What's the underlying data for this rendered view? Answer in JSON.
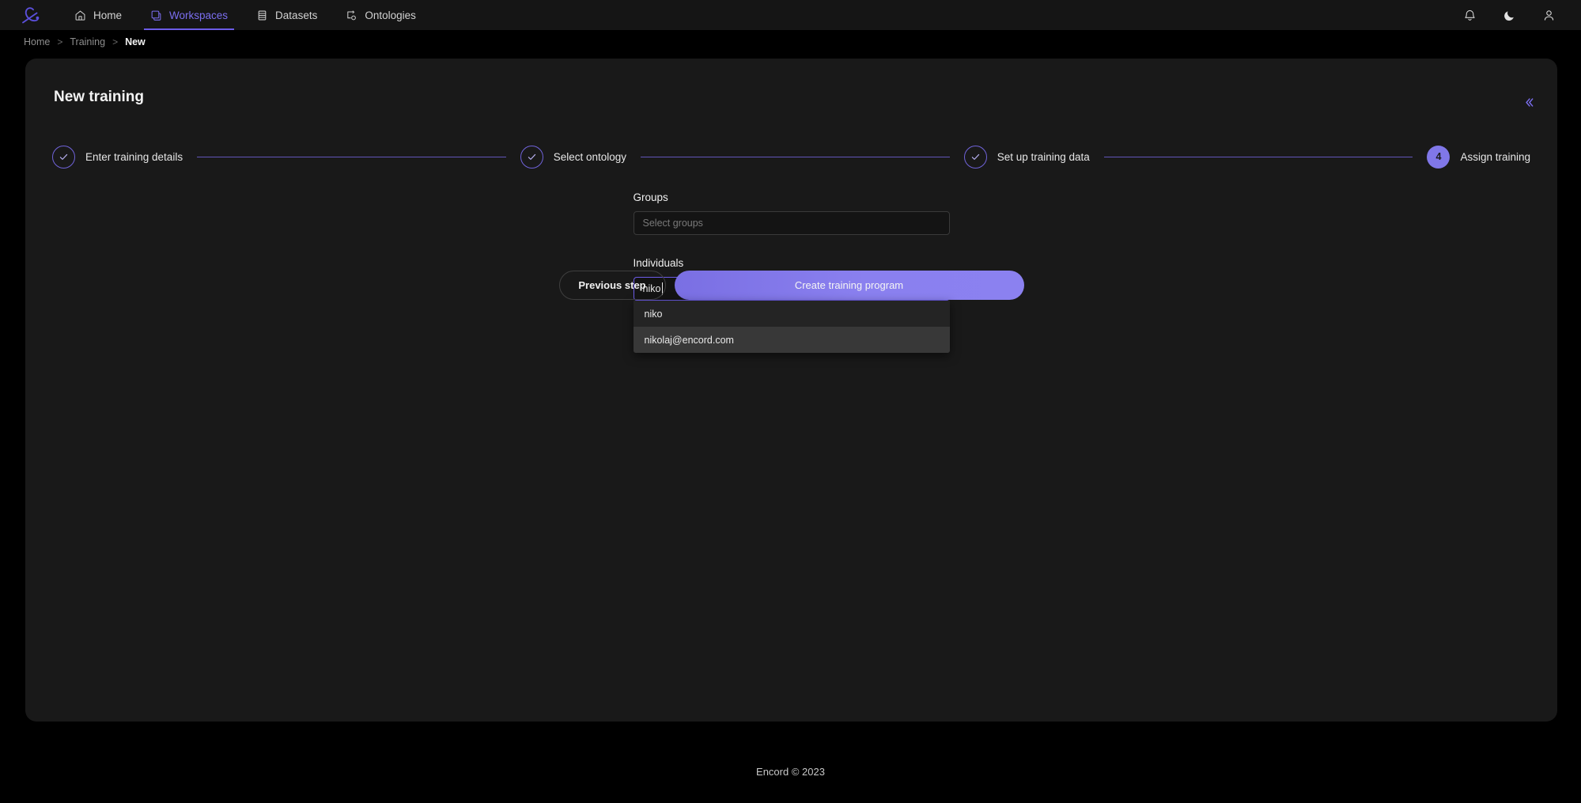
{
  "nav": {
    "logo_icon": "encord-logo-icon",
    "items": [
      {
        "label": "Home",
        "icon": "home-icon",
        "active": false
      },
      {
        "label": "Workspaces",
        "icon": "workspaces-icon",
        "active": true
      },
      {
        "label": "Datasets",
        "icon": "datasets-icon",
        "active": false
      },
      {
        "label": "Ontologies",
        "icon": "ontologies-icon",
        "active": false
      }
    ],
    "right_icons": [
      {
        "name": "notifications-bell-icon"
      },
      {
        "name": "dark-mode-moon-icon"
      },
      {
        "name": "user-account-icon"
      }
    ]
  },
  "breadcrumb": {
    "items": [
      {
        "label": "Home"
      },
      {
        "label": "Training"
      },
      {
        "label": "New"
      }
    ],
    "separator": ">"
  },
  "page": {
    "title": "New training",
    "collapse_icon": "chevron-double-left-icon"
  },
  "stepper": {
    "steps": [
      {
        "label": "Enter training details",
        "marker": "✓",
        "state": "done"
      },
      {
        "label": "Select ontology",
        "marker": "✓",
        "state": "done"
      },
      {
        "label": "Set up training data",
        "marker": "✓",
        "state": "done"
      },
      {
        "label": "Assign training",
        "marker": "4",
        "state": "active"
      }
    ]
  },
  "form": {
    "groups": {
      "label": "Groups",
      "placeholder": "Select groups",
      "value": ""
    },
    "individuals": {
      "label": "Individuals",
      "placeholder": "",
      "value": "niko",
      "dropdown_options": [
        {
          "label": "niko",
          "highlighted": false
        },
        {
          "label": "nikolaj@encord.com",
          "highlighted": true
        }
      ]
    }
  },
  "actions": {
    "previous_label": "Previous step",
    "create_label": "Create training program"
  },
  "footer": {
    "text": "Encord © 2023"
  },
  "colors": {
    "accent": "#6c5ce7",
    "accent_light": "#8077e8",
    "page_bg": "#000000",
    "card_bg": "#191919",
    "nav_bg": "#151515",
    "dropdown_bg": "#242424",
    "dropdown_highlight": "#383838"
  }
}
